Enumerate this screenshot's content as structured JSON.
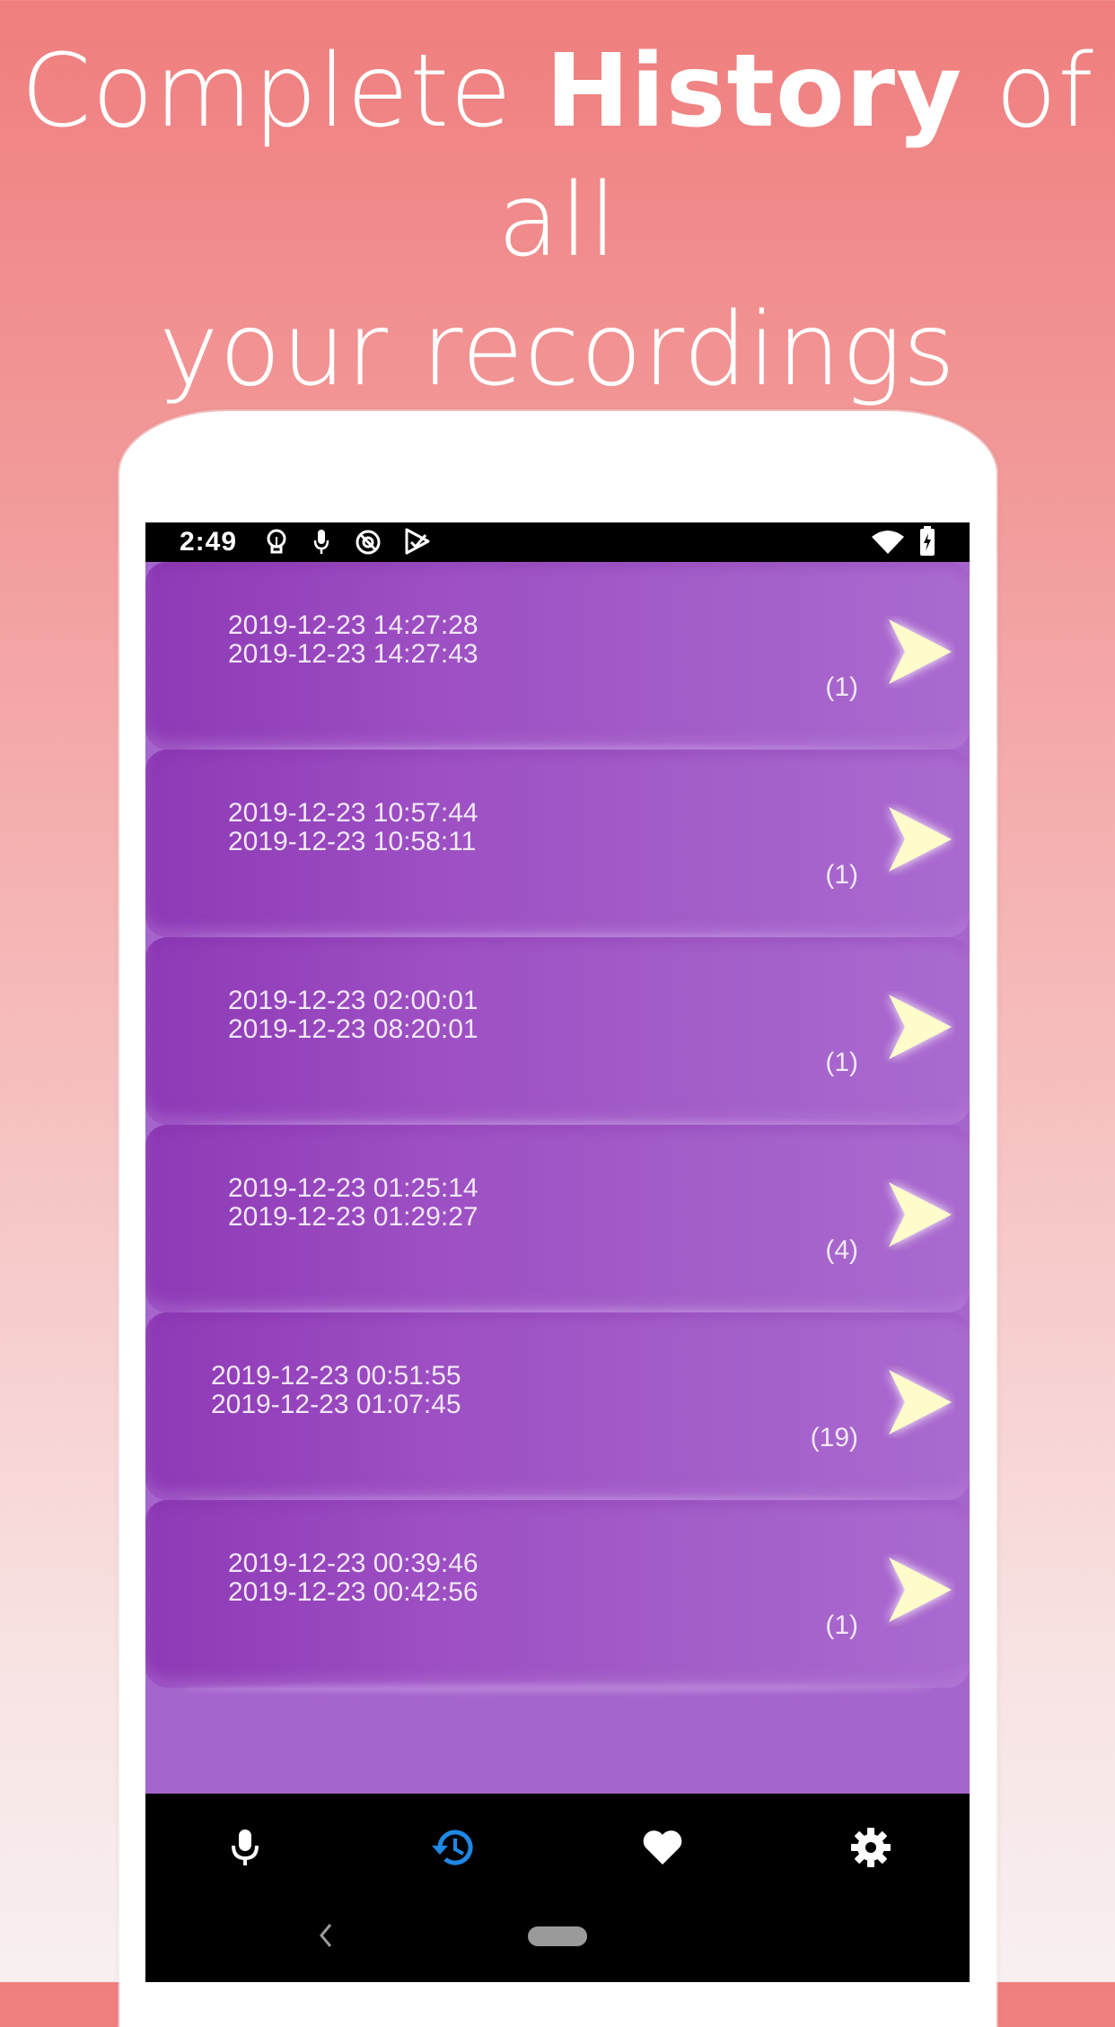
{
  "headline": {
    "part1": "Complete ",
    "bold": "History",
    "part2": " of all",
    "line2": "your recordings"
  },
  "status_bar": {
    "time": "2:49",
    "left_icons": [
      "lightbulb-icon",
      "mic-icon",
      "data-saver-icon",
      "play-store-icon"
    ],
    "right_icons": [
      "wifi-icon",
      "battery-charging-icon"
    ]
  },
  "history": {
    "items": [
      {
        "start": "2019-12-23 14:27:28",
        "end": "2019-12-23 14:27:43",
        "count": "(1)"
      },
      {
        "start": "2019-12-23 10:57:44",
        "end": "2019-12-23 10:58:11",
        "count": "(1)"
      },
      {
        "start": "2019-12-23 02:00:01",
        "end": "2019-12-23 08:20:01",
        "count": "(1)"
      },
      {
        "start": "2019-12-23 01:25:14",
        "end": "2019-12-23 01:29:27",
        "count": "(4)"
      },
      {
        "start": "2019-12-23 00:51:55",
        "end": "2019-12-23 01:07:45",
        "count": "(19)"
      },
      {
        "start": "2019-12-23 00:39:46",
        "end": "2019-12-23 00:42:56",
        "count": "(1)"
      }
    ]
  },
  "bottom_nav": {
    "items": [
      {
        "icon": "mic-icon",
        "active": false
      },
      {
        "icon": "history-icon",
        "active": true
      },
      {
        "icon": "heart-icon",
        "active": false
      },
      {
        "icon": "gear-icon",
        "active": false
      }
    ]
  },
  "colors": {
    "accent_active": "#1e88e5",
    "list_background": "#a665cd",
    "arrow": "#fffccc"
  }
}
